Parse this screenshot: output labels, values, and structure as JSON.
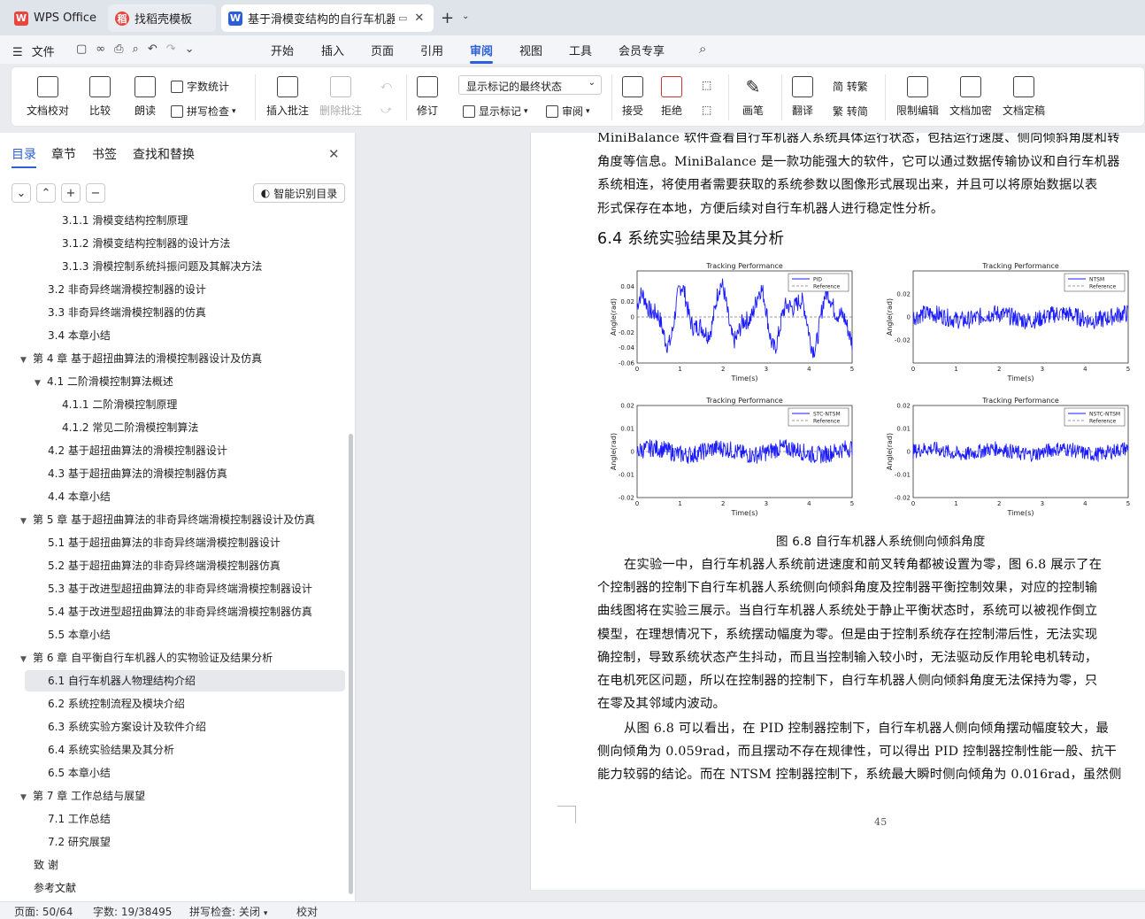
{
  "tabs": [
    {
      "label": "WPS Office",
      "logo": "W",
      "color": "#e8453c"
    },
    {
      "label": "找稻壳模板",
      "logo": "稻",
      "color": "#e8453c"
    },
    {
      "label": "基于滑模变结构的自行车机器人",
      "logo": "W",
      "color": "#2b5fd9"
    }
  ],
  "menubar": {
    "file": "文件",
    "items": [
      "开始",
      "插入",
      "页面",
      "引用",
      "审阅",
      "视图",
      "工具",
      "会员专享"
    ],
    "active": "审阅"
  },
  "ribbon": {
    "doc_check": "文档校对",
    "compare": "比较",
    "read_aloud": "朗读",
    "word_count": "字数统计",
    "spell_check": "拼写检查",
    "insert_comment": "插入批注",
    "delete_comment": "删除批注",
    "revise": "修订",
    "markup_dropdown": "显示标记的最终状态",
    "show_markup": "显示标记",
    "review": "审阅",
    "accept": "接受",
    "reject": "拒绝",
    "pen": "画笔",
    "translate": "翻译",
    "to_traditional": "简 转繁",
    "to_simplified": "繁 转简",
    "restrict_edit": "限制编辑",
    "encrypt": "文档加密",
    "finalize": "文档定稿"
  },
  "panel": {
    "tabs": [
      "目录",
      "章节",
      "书签",
      "查找和替换"
    ],
    "smart_toc": "智能识别目录",
    "toc": [
      {
        "text": "3.1.1 滑模变结构控制原理",
        "level": 3
      },
      {
        "text": "3.1.2  滑模变结构控制器的设计方法",
        "level": 3
      },
      {
        "text": "3.1.3 滑模控制系统抖振问题及其解决方法",
        "level": 3
      },
      {
        "text": "3.2  非奇异终端滑模控制器的设计",
        "level": 2
      },
      {
        "text": "3.3  非奇异终端滑模控制器的仿真",
        "level": 2
      },
      {
        "text": "3.4  本章小结",
        "level": 2
      },
      {
        "text": "第 4 章  基于超扭曲算法的滑模控制器设计及仿真",
        "level": 1
      },
      {
        "text": "4.1  二阶滑模控制算法概述",
        "level": 2,
        "arrow": true
      },
      {
        "text": "4.1.1  二阶滑模控制原理",
        "level": 3
      },
      {
        "text": "4.1.2  常见二阶滑模控制算法",
        "level": 3
      },
      {
        "text": "4.2  基于超扭曲算法的滑模控制器设计",
        "level": 2
      },
      {
        "text": "4.3  基于超扭曲算法的滑模控制器仿真",
        "level": 2
      },
      {
        "text": "4.4  本章小结",
        "level": 2
      },
      {
        "text": "第 5 章  基于超扭曲算法的非奇异终端滑模控制器设计及仿真",
        "level": 1
      },
      {
        "text": "5.1  基于超扭曲算法的非奇异终端滑模控制器设计",
        "level": 2
      },
      {
        "text": "5.2  基于超扭曲算法的非奇异终端滑模控制器仿真",
        "level": 2
      },
      {
        "text": "5.3  基于改进型超扭曲算法的非奇异终端滑模控制器设计",
        "level": 2
      },
      {
        "text": "5.4  基于改进型超扭曲算法的非奇异终端滑模控制器仿真",
        "level": 2
      },
      {
        "text": "5.5  本章小结",
        "level": 2
      },
      {
        "text": "第 6 章  自平衡自行车机器人的实物验证及结果分析",
        "level": 1
      },
      {
        "text": "6.1  自行车机器人物理结构介绍",
        "level": 2,
        "selected": true
      },
      {
        "text": "6.2  系统控制流程及模块介绍",
        "level": 2
      },
      {
        "text": "6.3  系统实验方案设计及软件介绍",
        "level": 2
      },
      {
        "text": "6.4  系统实验结果及其分析",
        "level": 2
      },
      {
        "text": "6.5  本章小结",
        "level": 2
      },
      {
        "text": "第 7 章  工作总结与展望",
        "level": 1
      },
      {
        "text": "7.1  工作总结",
        "level": 2
      },
      {
        "text": "7.2  研究展望",
        "level": 2
      },
      {
        "text": "致    谢",
        "level": 0
      },
      {
        "text": "参考文献",
        "level": 0
      }
    ]
  },
  "document": {
    "lines_top": [
      "MiniBalance 软件查看自行车机器人系统具体运行状态，包括运行速度、侧向倾斜角度和转",
      "角度等信息。MiniBalance 是一款功能强大的软件，它可以通过数据传输协议和自行车机器",
      "系统相连，将使用者需要获取的系统参数以图像形式展现出来，并且可以将原始数据以表",
      "形式保存在本地，方便后续对自行车机器人进行稳定性分析。"
    ],
    "heading": "6.4  系统实验结果及其分析",
    "figure_caption": "图 6.8  自行车机器人系统侧向倾斜角度",
    "lines_bottom": [
      "在实验一中，自行车机器人系统前进速度和前叉转角都被设置为零，图 6.8 展示了在",
      "个控制器的控制下自行车机器人系统侧向倾斜角度及控制器平衡控制效果，对应的控制输",
      "曲线图将在实验三展示。当自行车机器人系统处于静止平衡状态时，系统可以被视作倒立",
      "模型，在理想情况下，系统摆动幅度为零。但是由于控制系统存在控制滞后性，无法实现",
      "确控制，导致系统状态产生抖动，而且当控制输入较小时，无法驱动反作用轮电机转动，",
      "在电机死区问题，所以在控制器的控制下，自行车机器人侧向倾斜角度无法保持为零，只",
      "在零及其邻域内波动。",
      "从图 6.8 可以看出，在 PID 控制器控制下，自行车机器人侧向倾角摆动幅度较大，最",
      "侧向倾角为 0.059rad，而且摆动不存在规律性，可以得出 PID 控制器控制性能一般、抗干",
      "能力较弱的结论。而在 NTSM 控制器控制下，系统最大瞬时侧向倾角为 0.016rad，虽然侧"
    ],
    "page_number": "45"
  },
  "chart_data": [
    {
      "type": "line",
      "title": "Tracking Performance",
      "xlabel": "Time(s)",
      "ylabel": "Angle(rad)",
      "xlim": [
        0,
        5
      ],
      "ylim": [
        -0.06,
        0.06
      ],
      "xticks": [
        "0",
        "1",
        "2",
        "3",
        "4",
        "5"
      ],
      "yticks": [
        "0.04",
        "0.02",
        "0",
        "-0.02",
        "-0.04",
        "-0.06"
      ],
      "series": [
        {
          "name": "PID",
          "amplitude": 0.05
        },
        {
          "name": "Reference",
          "values": [
            0,
            0
          ]
        }
      ]
    },
    {
      "type": "line",
      "title": "Tracking Performance",
      "xlabel": "Time(s)",
      "ylabel": "Angle(rad)",
      "xlim": [
        0,
        5
      ],
      "ylim": [
        -0.04,
        0.04
      ],
      "xticks": [
        "0",
        "1",
        "2",
        "3",
        "4",
        "5"
      ],
      "yticks": [
        "0.02",
        "0",
        "-0.02"
      ],
      "series": [
        {
          "name": "NTSM",
          "amplitude": 0.012
        },
        {
          "name": "Reference",
          "values": [
            0,
            0
          ]
        }
      ]
    },
    {
      "type": "line",
      "title": "Tracking Performance",
      "xlabel": "Time(s)",
      "ylabel": "Angle(rad)",
      "xlim": [
        0,
        5
      ],
      "ylim": [
        -0.02,
        0.02
      ],
      "xticks": [
        "0",
        "1",
        "2",
        "3",
        "4",
        "5"
      ],
      "yticks": [
        "0.02",
        "0.01",
        "0",
        "-0.01",
        "-0.02"
      ],
      "series": [
        {
          "name": "STC-NTSM",
          "amplitude": 0.006
        },
        {
          "name": "Reference",
          "values": [
            0,
            0
          ]
        }
      ]
    },
    {
      "type": "line",
      "title": "Tracking Performance",
      "xlabel": "Time(s)",
      "ylabel": "Angle(rad)",
      "xlim": [
        0,
        5
      ],
      "ylim": [
        -0.02,
        0.02
      ],
      "xticks": [
        "0",
        "1",
        "2",
        "3",
        "4",
        "5"
      ],
      "yticks": [
        "0.02",
        "0.01",
        "0",
        "-0.01",
        "-0.02"
      ],
      "series": [
        {
          "name": "NSTC-NTSM",
          "amplitude": 0.005
        },
        {
          "name": "Reference",
          "values": [
            0,
            0
          ]
        }
      ]
    }
  ],
  "statusbar": {
    "page": "页面: 50/64",
    "words": "字数: 19/38495",
    "spell": "拼写检查: 关闭",
    "proof": "校对"
  }
}
